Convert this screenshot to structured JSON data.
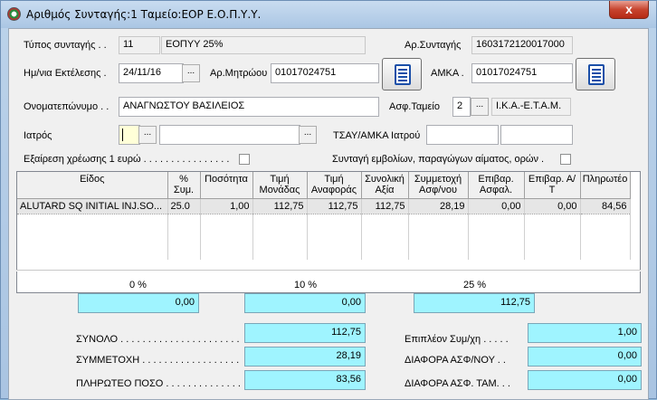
{
  "window": {
    "title": "Αριθμός Συνταγής:1  Ταμείο:ΕΟΡ Ε.Ο.Π.Υ.Υ.",
    "close_label": "x"
  },
  "form": {
    "type_label": "Τύπος συνταγής . .",
    "type_code": "11",
    "type_desc": "ΕΟΠΥΥ 25%",
    "rx_no_label": "Αρ.Συνταγής",
    "rx_no": "1603172120017000",
    "exec_date_label": "Ημ/νια Εκτέλεσης .",
    "exec_date": "24/11/16",
    "registry_label": "Αρ.Μητρώου",
    "registry": "01017024751",
    "amka_label": "ΑΜΚΑ .",
    "amka": "01017024751",
    "name_label": "Ονοματεπώνυμο . .",
    "name": "ΑΝΑΓΝΩΣΤΟΥ ΒΑΣΙΛΕΙΟΣ",
    "fund_label": "Ασφ.Ταμείο",
    "fund_code": "2",
    "fund_name": "Ι.Κ.Α.-Ε.Τ.Α.Μ.",
    "doctor_label": "Ιατρός",
    "doctor_code": "",
    "doctor_name": "",
    "tsay_label": "ΤΣΑΥ/ΑΜΚΑ Ιατρού",
    "tsay_value": "",
    "tsay_value2": "",
    "exempt_label": "Εξαίρεση χρέωσης 1 ευρώ . . . . . . . . . . . . . . . .",
    "vaccine_label": "Συνταγή εμβολίων, παραγώγων αίματος, ορών .",
    "dots": "..."
  },
  "grid": {
    "headers": [
      "Είδος",
      "% Συμ.",
      "Ποσότητα",
      "Τιμή Μονάδας",
      "Τιμή Αναφοράς",
      "Συνολική Αξία",
      "Συμμετοχή Ασφ/νου",
      "Επιβαρ. Ασφαλ.",
      "Επιβαρ. Α/Τ",
      "Πληρωτέο"
    ],
    "rows": [
      [
        "ALUTARD SQ INITIAL INJ.SO...",
        "25.0",
        "1,00",
        "112,75",
        "112,75",
        "112,75",
        "28,19",
        "0,00",
        "0,00",
        "84,56"
      ]
    ]
  },
  "totals": {
    "pct0_label": "0 %",
    "pct0_value": "0,00",
    "pct10_label": "10 %",
    "pct10_value": "0,00",
    "pct25_label": "25 %",
    "pct25_value": "112,75",
    "sum_label": "ΣΥΝΟΛΟ . . . . . . . . . . . . . . . . . . . . . .",
    "sum_value": "112,75",
    "part_label": "ΣΥΜΜΕΤΟΧΗ . . . . . . . . . . . . . . . . . .",
    "part_value": "28,19",
    "pay_label": "ΠΛΗΡΩΤΕΟ ΠΟΣΟ . . . . . . . . . . . . . . .",
    "pay_value": "83,56",
    "extra_label": "Επιπλέον Συμ/χη . . . . .",
    "extra_value": "1,00",
    "diff1_label": "ΔΙΑΦΟΡΑ ΑΣΦ/ΝΟΥ . .",
    "diff1_value": "0,00",
    "diff2_label": "ΔΙΑΦΟΡΑ ΑΣΦ. ΤΑΜ. . .",
    "diff2_value": "0,00"
  }
}
